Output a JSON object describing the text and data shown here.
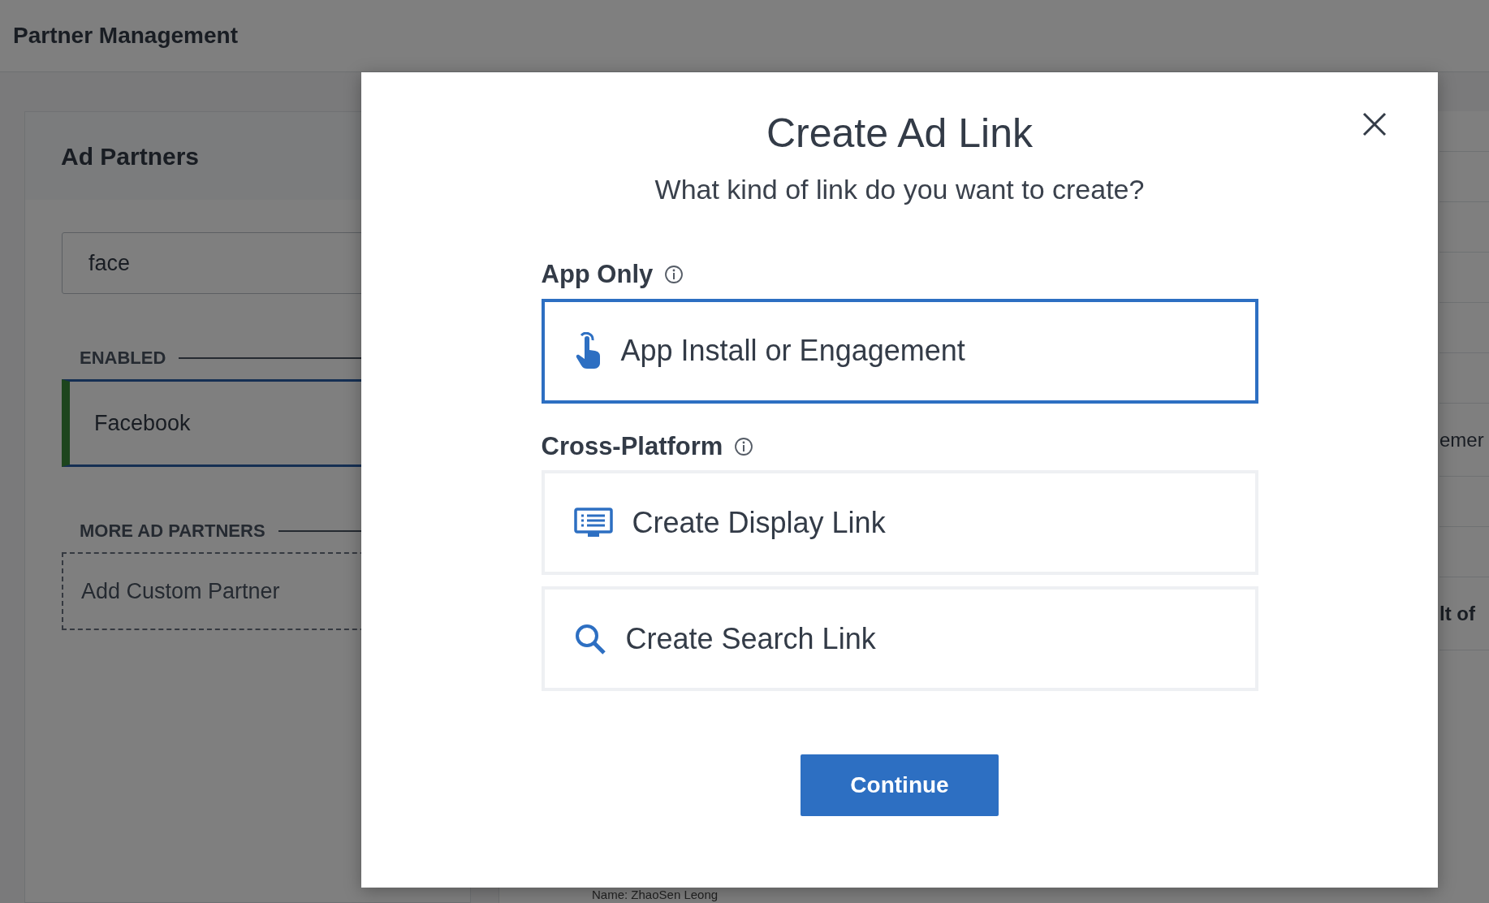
{
  "page": {
    "title": "Partner Management"
  },
  "ad_partners": {
    "title": "Ad Partners",
    "search": {
      "value": "face"
    },
    "enabled_label": "ENABLED",
    "enabled_partners": [
      {
        "name": "Facebook",
        "selected": true
      }
    ],
    "more_label": "MORE AD PARTNERS",
    "add_custom_label": "Add Custom Partner"
  },
  "background_details": {
    "text_1": "emer",
    "text_2": "lt of",
    "name_line": "Name: ZhaoSen Leong"
  },
  "modal": {
    "title": "Create Ad Link",
    "subtitle": "What kind of link do you want to create?",
    "groups": [
      {
        "label": "App Only",
        "options": [
          {
            "label": "App Install or Engagement",
            "kind": "touch",
            "selected": true
          }
        ]
      },
      {
        "label": "Cross-Platform",
        "options": [
          {
            "label": "Create Display Link",
            "kind": "display",
            "selected": false
          },
          {
            "label": "Create Search Link",
            "kind": "search",
            "selected": false
          }
        ]
      }
    ],
    "button": "Continue"
  }
}
